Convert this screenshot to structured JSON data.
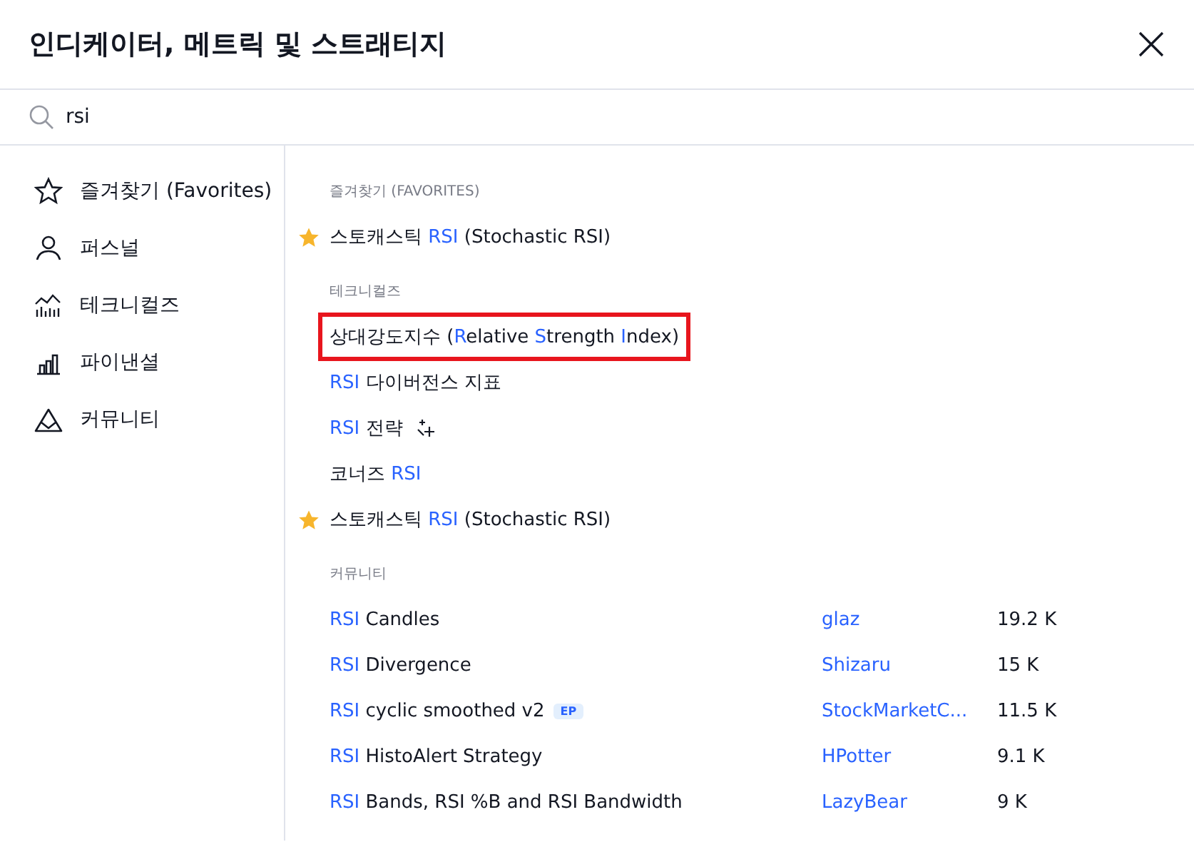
{
  "dialog": {
    "title": "인디케이터, 메트릭 및 스트래티지"
  },
  "search": {
    "value": "rsi"
  },
  "sidebar": {
    "items": [
      {
        "label": "즐겨찾기 (Favorites)",
        "kind": "favorites",
        "selected": false
      },
      {
        "label": "퍼스널",
        "kind": "personal",
        "selected": false
      },
      {
        "label": "테크니컬즈",
        "kind": "technicals",
        "selected": false
      },
      {
        "label": "파이낸셜",
        "kind": "financials",
        "selected": false
      },
      {
        "label": "커뮤니티",
        "kind": "community",
        "selected": false
      }
    ]
  },
  "sections": [
    {
      "heading": "즐겨찾기 (FAVORITES)",
      "items": [
        {
          "parts": [
            {
              "text": "스토캐스틱 ",
              "match": false
            },
            {
              "text": "RSI",
              "match": true
            },
            {
              "text": " (Stochastic RSI)",
              "match": false
            }
          ],
          "favorite": true,
          "highlighted": false,
          "kind": "indicator"
        }
      ]
    },
    {
      "heading": "테크니컬즈",
      "items": [
        {
          "parts": [
            {
              "text": "상대강도지수 (",
              "match": false
            },
            {
              "text": "R",
              "match": true
            },
            {
              "text": "elative ",
              "match": false
            },
            {
              "text": "S",
              "match": true
            },
            {
              "text": "trength ",
              "match": false
            },
            {
              "text": "I",
              "match": true
            },
            {
              "text": "ndex)",
              "match": false
            }
          ],
          "favorite": false,
          "highlighted": true,
          "kind": "indicator"
        },
        {
          "parts": [
            {
              "text": "RSI",
              "match": true
            },
            {
              "text": " 다이버전스 지표",
              "match": false
            }
          ],
          "favorite": false,
          "highlighted": false,
          "kind": "indicator"
        },
        {
          "parts": [
            {
              "text": "RSI",
              "match": true
            },
            {
              "text": " 전략",
              "match": false
            }
          ],
          "favorite": false,
          "highlighted": false,
          "kind": "strategy"
        },
        {
          "parts": [
            {
              "text": "코너즈 ",
              "match": false
            },
            {
              "text": "RSI",
              "match": true
            }
          ],
          "favorite": false,
          "highlighted": false,
          "kind": "indicator"
        },
        {
          "parts": [
            {
              "text": "스토캐스틱 ",
              "match": false
            },
            {
              "text": "RSI",
              "match": true
            },
            {
              "text": " (Stochastic RSI)",
              "match": false
            }
          ],
          "favorite": true,
          "highlighted": false,
          "kind": "indicator"
        }
      ]
    },
    {
      "heading": "커뮤니티",
      "items": [
        {
          "parts": [
            {
              "text": "RSI",
              "match": true
            },
            {
              "text": " Candles",
              "match": false
            }
          ],
          "author": "glaz",
          "count": "19.2 K",
          "favorite": false,
          "highlighted": false,
          "kind": "indicator"
        },
        {
          "parts": [
            {
              "text": "RSI",
              "match": true
            },
            {
              "text": " Divergence",
              "match": false
            }
          ],
          "author": "Shizaru",
          "count": "15 K",
          "favorite": false,
          "highlighted": false,
          "kind": "indicator"
        },
        {
          "parts": [
            {
              "text": "RSI",
              "match": true
            },
            {
              "text": " cyclic smoothed v2",
              "match": false
            }
          ],
          "badge": "EP",
          "author": "StockMarketC...",
          "count": "11.5 K",
          "favorite": false,
          "highlighted": false,
          "kind": "indicator"
        },
        {
          "parts": [
            {
              "text": "RSI",
              "match": true
            },
            {
              "text": " HistoAlert Strategy",
              "match": false
            }
          ],
          "author": "HPotter",
          "count": "9.1 K",
          "favorite": false,
          "highlighted": false,
          "kind": "indicator"
        },
        {
          "parts": [
            {
              "text": "RSI",
              "match": true
            },
            {
              "text": " Bands, RSI %B and RSI Bandwidth",
              "match": false
            }
          ],
          "author": "LazyBear",
          "count": "9 K",
          "favorite": false,
          "highlighted": false,
          "kind": "indicator"
        }
      ]
    }
  ]
}
